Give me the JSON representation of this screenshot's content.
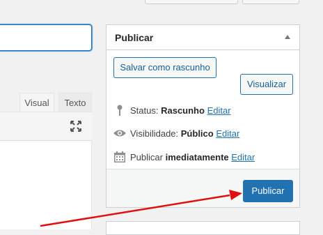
{
  "publish": {
    "title": "Publicar",
    "save_draft_label": "Salvar como rascunho",
    "preview_label": "Visualizar",
    "status_label": "Status:",
    "status_value": "Rascunho",
    "visibility_label": "Visibilidade:",
    "visibility_value": "Público",
    "schedule_label": "Publicar",
    "schedule_value": "imediatamente",
    "edit_label": "Editar",
    "publish_button_label": "Publicar"
  },
  "editor": {
    "tab_visual": "Visual",
    "tab_text": "Texto"
  },
  "colors": {
    "primary": "#2271b1",
    "annotation_arrow": "#e01010"
  },
  "icons": [
    "pin-icon",
    "eye-icon",
    "calendar-icon",
    "expand-icon",
    "toggle-arrow-icon"
  ]
}
